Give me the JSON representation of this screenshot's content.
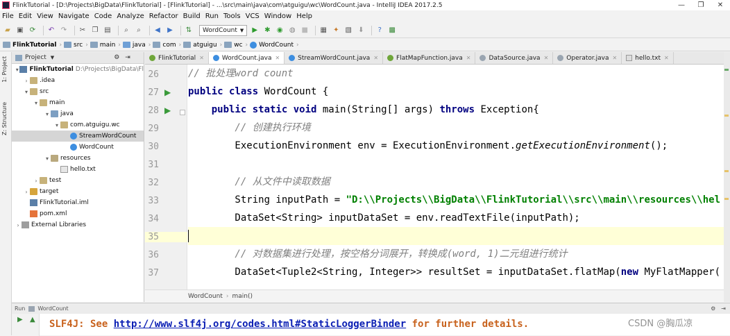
{
  "window": {
    "title": "FlinkTutorial - [D:\\Projects\\BigData\\FlinkTutorial] - [FlinkTutorial] - ...\\src\\main\\java\\com\\atguigu\\wc\\WordCount.java - IntelliJ IDEA 2017.2.5",
    "minimize": "—",
    "maximize": "❐",
    "close": "✕"
  },
  "menu": [
    "File",
    "Edit",
    "View",
    "Navigate",
    "Code",
    "Analyze",
    "Refactor",
    "Build",
    "Run",
    "Tools",
    "VCS",
    "Window",
    "Help"
  ],
  "toolbar": {
    "run_config": "WordCount"
  },
  "breadcrumb": [
    "FlinkTutorial",
    "src",
    "main",
    "java",
    "com",
    "atguigu",
    "wc",
    "WordCount"
  ],
  "project_panel": {
    "title": "Project",
    "root": "FlinkTutorial",
    "root_path": "D:\\Projects\\BigData\\Fl",
    "items": [
      {
        "label": "FlinkTutorial",
        "indent": 0
      },
      {
        "label": ".idea",
        "indent": 1
      },
      {
        "label": "src",
        "indent": 1
      },
      {
        "label": "main",
        "indent": 2
      },
      {
        "label": "java",
        "indent": 3
      },
      {
        "label": "com.atguigu.wc",
        "indent": 4
      },
      {
        "label": "StreamWordCount",
        "indent": 5
      },
      {
        "label": "WordCount",
        "indent": 5
      },
      {
        "label": "resources",
        "indent": 3
      },
      {
        "label": "hello.txt",
        "indent": 4
      },
      {
        "label": "test",
        "indent": 2
      },
      {
        "label": "target",
        "indent": 1
      },
      {
        "label": "FlinkTutorial.iml",
        "indent": 1
      },
      {
        "label": "pom.xml",
        "indent": 1
      },
      {
        "label": "External Libraries",
        "indent": 0
      }
    ]
  },
  "side_tabs": {
    "project": "1: Project",
    "structure": "Z: Structure"
  },
  "tabs": [
    {
      "label": "FlinkTutorial",
      "active": false
    },
    {
      "label": "WordCount.java",
      "active": true
    },
    {
      "label": "StreamWordCount.java",
      "active": false
    },
    {
      "label": "FlatMapFunction.java",
      "active": false
    },
    {
      "label": "DataSource.java",
      "active": false
    },
    {
      "label": "Operator.java",
      "active": false
    },
    {
      "label": "hello.txt",
      "active": false
    }
  ],
  "code": {
    "line_numbers": [
      "26",
      "27",
      "28",
      "29",
      "30",
      "31",
      "32",
      "33",
      "34",
      "35",
      "36",
      "37"
    ],
    "l26": "// 批处理word count",
    "l27a": "public class ",
    "l27b": "WordCount {",
    "l28a": "    public static void ",
    "l28b": "main(String[] args) ",
    "l28c": "throws ",
    "l28d": "Exception{",
    "l29": "        // 创建执行环境",
    "l30a": "        ExecutionEnvironment env = ExecutionEnvironment.",
    "l30b": "getExecutionEnvironment",
    "l30c": "();",
    "l31": "",
    "l32": "        // 从文件中读取数据",
    "l33a": "        String inputPath = ",
    "l33b": "\"D:\\\\Projects\\\\BigData\\\\FlinkTutorial\\\\src\\\\main\\\\resources\\\\hel",
    "l34": "        DataSet<String> inputDataSet = env.readTextFile(inputPath);",
    "l35": "",
    "l36": "        // 对数据集进行处理，按空格分词展开，转换成(word, 1)二元组进行统计",
    "l37a": "        DataSet<Tuple2<String, Integer>> resultSet = inputDataSet.flatMap(",
    "l37b": "new ",
    "l37c": "MyFlatMapper("
  },
  "editor_breadcrumb": [
    "WordCount",
    "main()"
  ],
  "run_panel": {
    "title": "Run",
    "config": "WordCount",
    "console_prefix": "SLF4J: See ",
    "console_link": "http://www.slf4j.org/codes.html#StaticLoggerBinder",
    "console_suffix": " for further details."
  },
  "watermark": "CSDN @胸瓜凉"
}
